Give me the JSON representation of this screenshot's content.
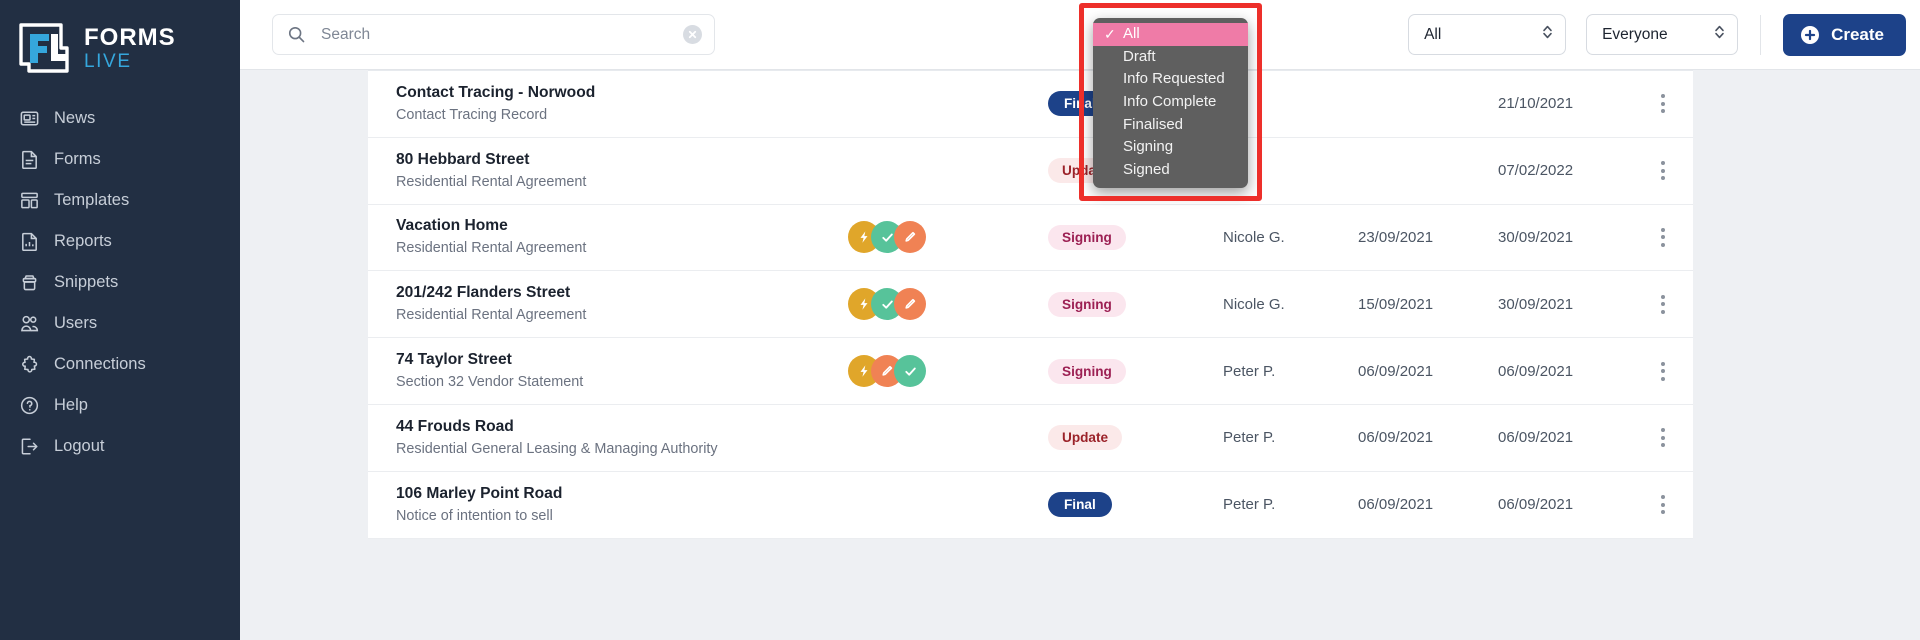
{
  "brand": {
    "line1": "FORMS",
    "line2": "LIVE",
    "logo_icon": "forms-live-logo"
  },
  "sidebar": {
    "items": [
      {
        "label": "News",
        "icon": "news-icon"
      },
      {
        "label": "Forms",
        "icon": "document-icon"
      },
      {
        "label": "Templates",
        "icon": "templates-icon"
      },
      {
        "label": "Reports",
        "icon": "reports-chart-icon"
      },
      {
        "label": "Snippets",
        "icon": "snippets-icon"
      },
      {
        "label": "Users",
        "icon": "users-icon"
      },
      {
        "label": "Connections",
        "icon": "puzzle-icon"
      },
      {
        "label": "Help",
        "icon": "question-circle-icon"
      },
      {
        "label": "Logout",
        "icon": "logout-icon"
      }
    ]
  },
  "topbar": {
    "search": {
      "placeholder": "Search",
      "value": "",
      "icon": "search-icon",
      "clear_icon": "clear-circle-icon"
    },
    "status_filter": {
      "selected": "All",
      "icon": "chevron-updown-icon"
    },
    "scope_filter": {
      "selected": "Everyone",
      "icon": "chevron-updown-icon"
    },
    "create": {
      "label": "Create",
      "icon": "plus-circle-icon"
    }
  },
  "status_dropdown": {
    "open": true,
    "highlight_color": "#ed2f2a",
    "selected_bg": "#ef7ba7",
    "menu_bg": "#5f5f5f",
    "check_glyph": "✓",
    "options": [
      {
        "label": "All",
        "selected": true
      },
      {
        "label": "Draft",
        "selected": false
      },
      {
        "label": "Info Requested",
        "selected": false
      },
      {
        "label": "Info Complete",
        "selected": false
      },
      {
        "label": "Finalised",
        "selected": false
      },
      {
        "label": "Signing",
        "selected": false
      },
      {
        "label": "Signed",
        "selected": false
      }
    ]
  },
  "table": {
    "rows": [
      {
        "title": "Contact Tracing - Norwood",
        "subtitle": "Contact Tracing Record",
        "signatories": [],
        "status": {
          "label": "Final",
          "style": "final"
        },
        "user": "",
        "date1": "",
        "date2": "21/10/2021",
        "menu_icon": "kebab-menu-icon"
      },
      {
        "title": "80 Hebbard Street",
        "subtitle": "Residential Rental Agreement",
        "signatories": [],
        "status": {
          "label": "Update",
          "style": "update"
        },
        "user": "",
        "date1": "",
        "date2": "07/02/2022",
        "menu_icon": "kebab-menu-icon"
      },
      {
        "title": "Vacation Home",
        "subtitle": "Residential Rental Agreement",
        "signatories": [
          {
            "color": "gold",
            "icon": "lightning-icon"
          },
          {
            "color": "green",
            "icon": "check-icon"
          },
          {
            "color": "orange",
            "icon": "pencil-icon"
          }
        ],
        "status": {
          "label": "Signing",
          "style": "signing"
        },
        "user": "Nicole G.",
        "date1": "23/09/2021",
        "date2": "30/09/2021",
        "menu_icon": "kebab-menu-icon"
      },
      {
        "title": "201/242 Flanders Street",
        "subtitle": "Residential Rental Agreement",
        "signatories": [
          {
            "color": "gold",
            "icon": "lightning-icon"
          },
          {
            "color": "green",
            "icon": "check-icon"
          },
          {
            "color": "orange",
            "icon": "pencil-icon"
          }
        ],
        "status": {
          "label": "Signing",
          "style": "signing"
        },
        "user": "Nicole G.",
        "date1": "15/09/2021",
        "date2": "30/09/2021",
        "menu_icon": "kebab-menu-icon"
      },
      {
        "title": "74 Taylor Street",
        "subtitle": "Section 32 Vendor Statement",
        "signatories": [
          {
            "color": "gold",
            "icon": "lightning-icon"
          },
          {
            "color": "orange",
            "icon": "pencil-icon"
          },
          {
            "color": "green",
            "icon": "check-icon"
          }
        ],
        "status": {
          "label": "Signing",
          "style": "signing"
        },
        "user": "Peter P.",
        "date1": "06/09/2021",
        "date2": "06/09/2021",
        "menu_icon": "kebab-menu-icon"
      },
      {
        "title": "44 Frouds Road",
        "subtitle": "Residential General Leasing & Managing Authority",
        "signatories": [],
        "status": {
          "label": "Update",
          "style": "update"
        },
        "user": "Peter P.",
        "date1": "06/09/2021",
        "date2": "06/09/2021",
        "menu_icon": "kebab-menu-icon"
      },
      {
        "title": "106 Marley Point Road",
        "subtitle": "Notice of intention to sell",
        "signatories": [],
        "status": {
          "label": "Final",
          "style": "final"
        },
        "user": "Peter P.",
        "date1": "06/09/2021",
        "date2": "06/09/2021",
        "menu_icon": "kebab-menu-icon"
      }
    ]
  },
  "colors": {
    "sidebar_bg": "#222f43",
    "brand_accent": "#35a7dd",
    "primary": "#1d4289",
    "page_bg": "#eef0f3"
  }
}
